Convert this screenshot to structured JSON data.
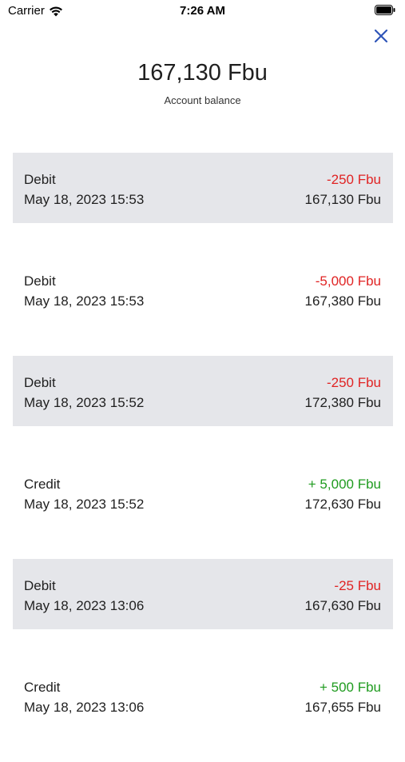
{
  "status_bar": {
    "carrier": "Carrier",
    "time": "7:26 AM",
    "wifi_icon": "wifi-icon",
    "battery_icon": "battery-icon"
  },
  "header": {
    "close_icon": "close-icon",
    "close_color": "#2f55b8",
    "balance": "167,130 Fbu",
    "balance_label": "Account balance"
  },
  "colors": {
    "debit": "#e02323",
    "credit": "#1f9b1f",
    "shaded_row": "#e5e6ea"
  },
  "transactions": [
    {
      "type": "Debit",
      "date": "May 18, 2023 15:53",
      "amount": "-250 Fbu",
      "balance": "167,130 Fbu",
      "kind": "debit"
    },
    {
      "type": "Debit",
      "date": "May 18, 2023 15:53",
      "amount": "-5,000 Fbu",
      "balance": "167,380 Fbu",
      "kind": "debit"
    },
    {
      "type": "Debit",
      "date": "May 18, 2023 15:52",
      "amount": "-250 Fbu",
      "balance": "172,380 Fbu",
      "kind": "debit"
    },
    {
      "type": "Credit",
      "date": "May 18, 2023 15:52",
      "amount": "+ 5,000 Fbu",
      "balance": "172,630 Fbu",
      "kind": "credit"
    },
    {
      "type": "Debit",
      "date": "May 18, 2023 13:06",
      "amount": "-25 Fbu",
      "balance": "167,630 Fbu",
      "kind": "debit"
    },
    {
      "type": "Credit",
      "date": "May 18, 2023 13:06",
      "amount": "+ 500 Fbu",
      "balance": "167,655 Fbu",
      "kind": "credit"
    }
  ]
}
